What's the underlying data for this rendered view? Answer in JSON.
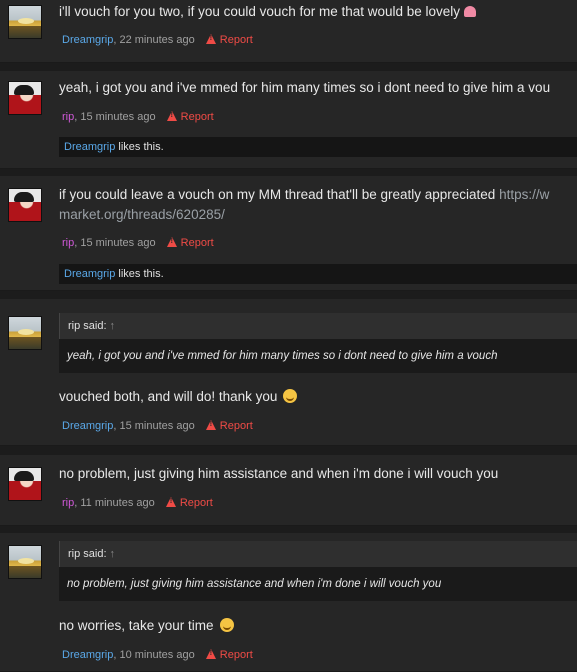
{
  "posts": [
    {
      "user": "Dreamgrip",
      "message": "i'll vouch for you two, if you could vouch for me that would be lovely",
      "time": ", 22 minutes ago",
      "report": "Report"
    },
    {
      "user": "rip",
      "message": "yeah, i got you and i've mmed for him many times so i dont need to give him a vou",
      "time": ", 15 minutes ago",
      "report": "Report",
      "likes_user": "Dreamgrip",
      "likes_text": " likes this."
    },
    {
      "user": "rip",
      "message_line1": "if you could leave a vouch on my MM thread that'll be greatly appreciated ",
      "message_link1": "https://w",
      "message_line2": "market.org/threads/620285/",
      "time": ", 15 minutes ago",
      "report": "Report",
      "likes_user": "Dreamgrip",
      "likes_text": " likes this."
    },
    {
      "user": "Dreamgrip",
      "quote_author": "rip said:",
      "quote_arrow": "↑",
      "quote_text": "yeah, i got you and i've mmed for him many times so i dont need to give him a vouch",
      "message": "vouched both, and will do! thank you",
      "time": ", 15 minutes ago",
      "report": "Report"
    },
    {
      "user": "rip",
      "message": "no problem, just giving him assistance and when i'm done i will vouch you",
      "time": ", 11 minutes ago",
      "report": "Report"
    },
    {
      "user": "Dreamgrip",
      "quote_author": "rip said:",
      "quote_arrow": "↑",
      "quote_text": "no problem, just giving him assistance and when i'm done i will vouch you",
      "message": "no worries, take your time",
      "time": ", 10 minutes ago",
      "report": "Report"
    }
  ],
  "colors": {
    "background": "#1c1c1c",
    "post_background": "#262626",
    "dreamgrip_name": "#5aa8e8",
    "rip_name": "#d058d8",
    "report": "#ef4b46"
  },
  "icons": {
    "report": "warning-triangle-icon",
    "heart": "heart-emoji-icon",
    "smile": "smile-emoji-icon"
  }
}
